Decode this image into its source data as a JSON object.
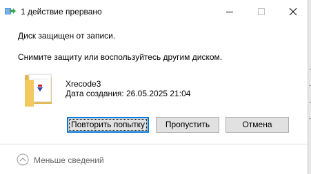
{
  "window": {
    "title": "1 действие прервано",
    "icon": "file-move-icon"
  },
  "controls": {
    "minimize_icon": "minimize-icon",
    "maximize_icon": "maximize-icon",
    "close_icon": "close-icon"
  },
  "message": {
    "line1": "Диск защищен от записи.",
    "line2": "Снимите защиту или воспользуйтесь другим диском."
  },
  "file": {
    "icon": "folder-icon",
    "name": "Xrecode3",
    "created": "Дата создания: 26.05.2025 21:04"
  },
  "buttons": {
    "retry": "Повторить попытку",
    "skip": "Пропустить",
    "cancel": "Отмена"
  },
  "details": {
    "label": "Меньше сведений",
    "icon": "chevron-up-icon"
  },
  "colors": {
    "accent": "#0078d7",
    "button_bg": "#e1e1e1",
    "button_border": "#adadad",
    "muted_text": "#666666"
  }
}
